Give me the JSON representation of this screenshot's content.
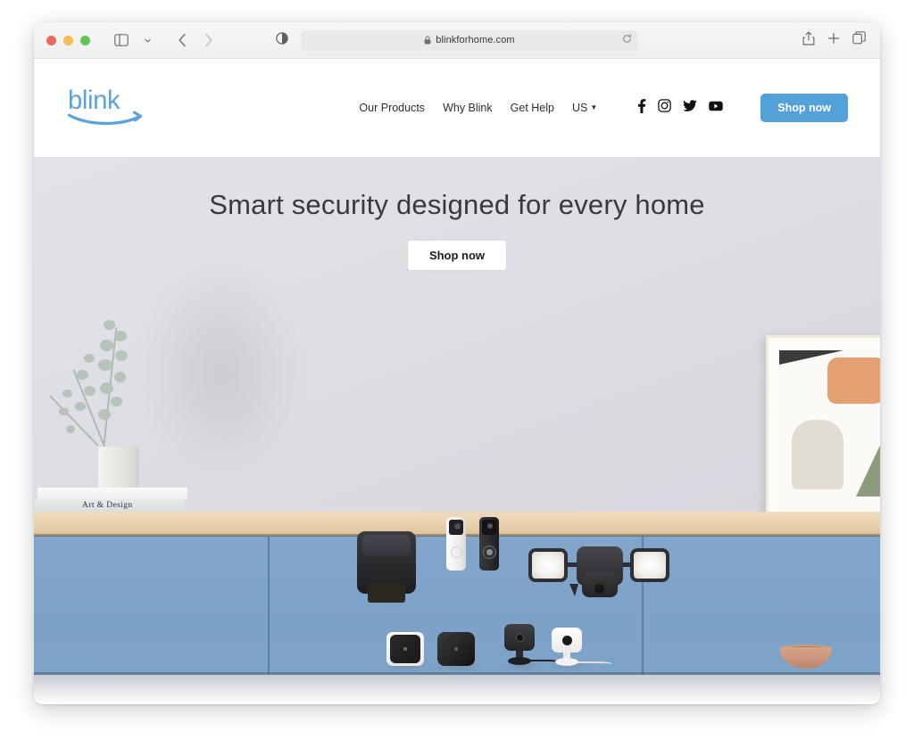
{
  "browser": {
    "traffic_lights": [
      "close",
      "minimize",
      "zoom"
    ],
    "sidebar_button": "sidebar-toggle",
    "tab_overview_chevron": "chevron-down",
    "back_label": "Back",
    "forward_label": "Forward",
    "privacy_icon": "shield-contrast-icon",
    "address": {
      "lock": "lock-icon",
      "url": "blinkforhome.com",
      "reload": "reload-icon"
    },
    "right_buttons": [
      {
        "name": "share-icon",
        "label": "Share"
      },
      {
        "name": "new-tab-icon",
        "label": "New Tab"
      },
      {
        "name": "tab-overview-icon",
        "label": "Tab Overview"
      }
    ]
  },
  "site": {
    "logo": {
      "wordmark": "blink",
      "icon": "blink-smile-arrow-logo"
    },
    "nav": [
      {
        "label": "Our Products"
      },
      {
        "label": "Why Blink"
      },
      {
        "label": "Get Help"
      }
    ],
    "locale": {
      "label": "US",
      "chevron": "▼"
    },
    "social": [
      {
        "name": "facebook-icon",
        "label": "Facebook"
      },
      {
        "name": "instagram-icon",
        "label": "Instagram"
      },
      {
        "name": "twitter-icon",
        "label": "Twitter"
      },
      {
        "name": "youtube-icon",
        "label": "YouTube"
      }
    ],
    "header_cta": "Shop now"
  },
  "hero": {
    "title": "Smart security designed for every home",
    "cta": "Shop now",
    "scene": {
      "books_label": "Art & Design",
      "products": [
        "outdoor-camera-with-solar-panel",
        "white-video-doorbell",
        "black-video-doorbell",
        "floodlight-camera",
        "white-indoor-camera",
        "black-outdoor-camera",
        "black-mini-camera",
        "white-mini-camera"
      ]
    }
  },
  "colors": {
    "brand_blue": "#54a0d8",
    "logo_blue": "#5ba3d9",
    "hero_background": "#dcdde3",
    "cabinet_blue": "#7da2c8",
    "countertop_wood": "#e8d0ac",
    "hero_title": "#3a3a3e"
  }
}
